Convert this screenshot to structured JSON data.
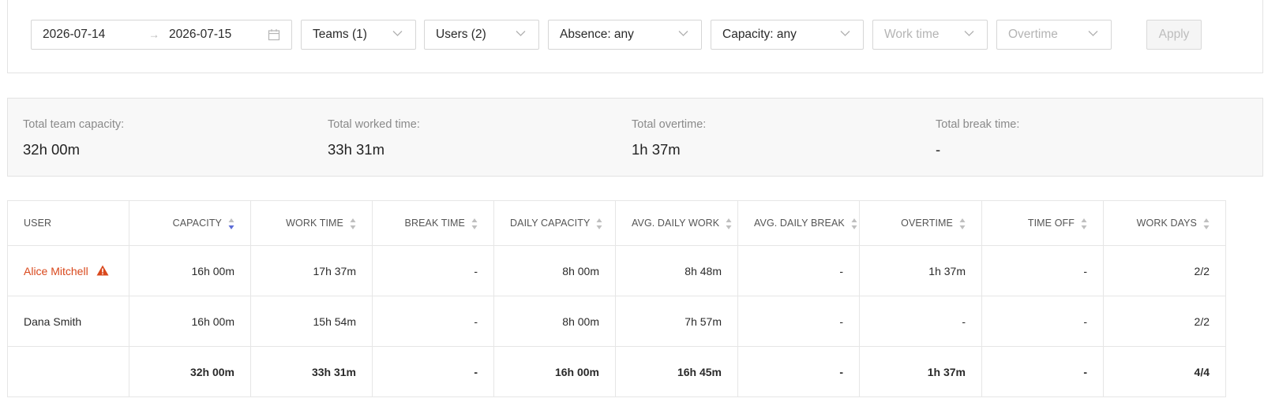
{
  "filters": {
    "date_from": "2026-07-14",
    "date_to": "2026-07-15",
    "date_arrow": "→",
    "teams": "Teams (1)",
    "users": "Users (2)",
    "absence": "Absence: any",
    "capacity": "Capacity: any",
    "work_time_placeholder": "Work time",
    "overtime_placeholder": "Overtime",
    "apply_label": "Apply"
  },
  "summary": {
    "team_capacity_label": "Total team capacity:",
    "team_capacity_value": "32h 00m",
    "worked_label": "Total worked time:",
    "worked_value": "33h 31m",
    "overtime_label": "Total overtime:",
    "overtime_value": "1h 37m",
    "break_label": "Total break time:",
    "break_value": "-"
  },
  "table": {
    "columns": [
      "USER",
      "CAPACITY",
      "WORK TIME",
      "BREAK TIME",
      "DAILY CAPACITY",
      "AVG. DAILY WORK",
      "AVG. DAILY BREAK",
      "OVERTIME",
      "TIME OFF",
      "WORK DAYS"
    ],
    "active_sort_column": "CAPACITY",
    "rows": [
      {
        "user": "Alice Mitchell",
        "warning": true,
        "cells": [
          "16h 00m",
          "17h 37m",
          "-",
          "8h 00m",
          "8h 48m",
          "-",
          "1h 37m",
          "-",
          "2/2"
        ]
      },
      {
        "user": "Dana Smith",
        "warning": false,
        "cells": [
          "16h 00m",
          "15h 54m",
          "-",
          "8h 00m",
          "7h 57m",
          "-",
          "-",
          "-",
          "2/2"
        ]
      }
    ],
    "totals": {
      "user": "",
      "cells": [
        "32h 00m",
        "33h 31m",
        "-",
        "16h 00m",
        "16h 45m",
        "-",
        "1h 37m",
        "-",
        "4/4"
      ]
    }
  },
  "colors": {
    "warning": "#d9481c",
    "sort_active": "#5b6bd6",
    "sort_inactive": "#bfbfbf"
  },
  "icons": {
    "calendar": "calendar-icon",
    "chevron": "chevron-down-icon",
    "warning": "warning-triangle-icon",
    "sort": "sort-icon"
  }
}
